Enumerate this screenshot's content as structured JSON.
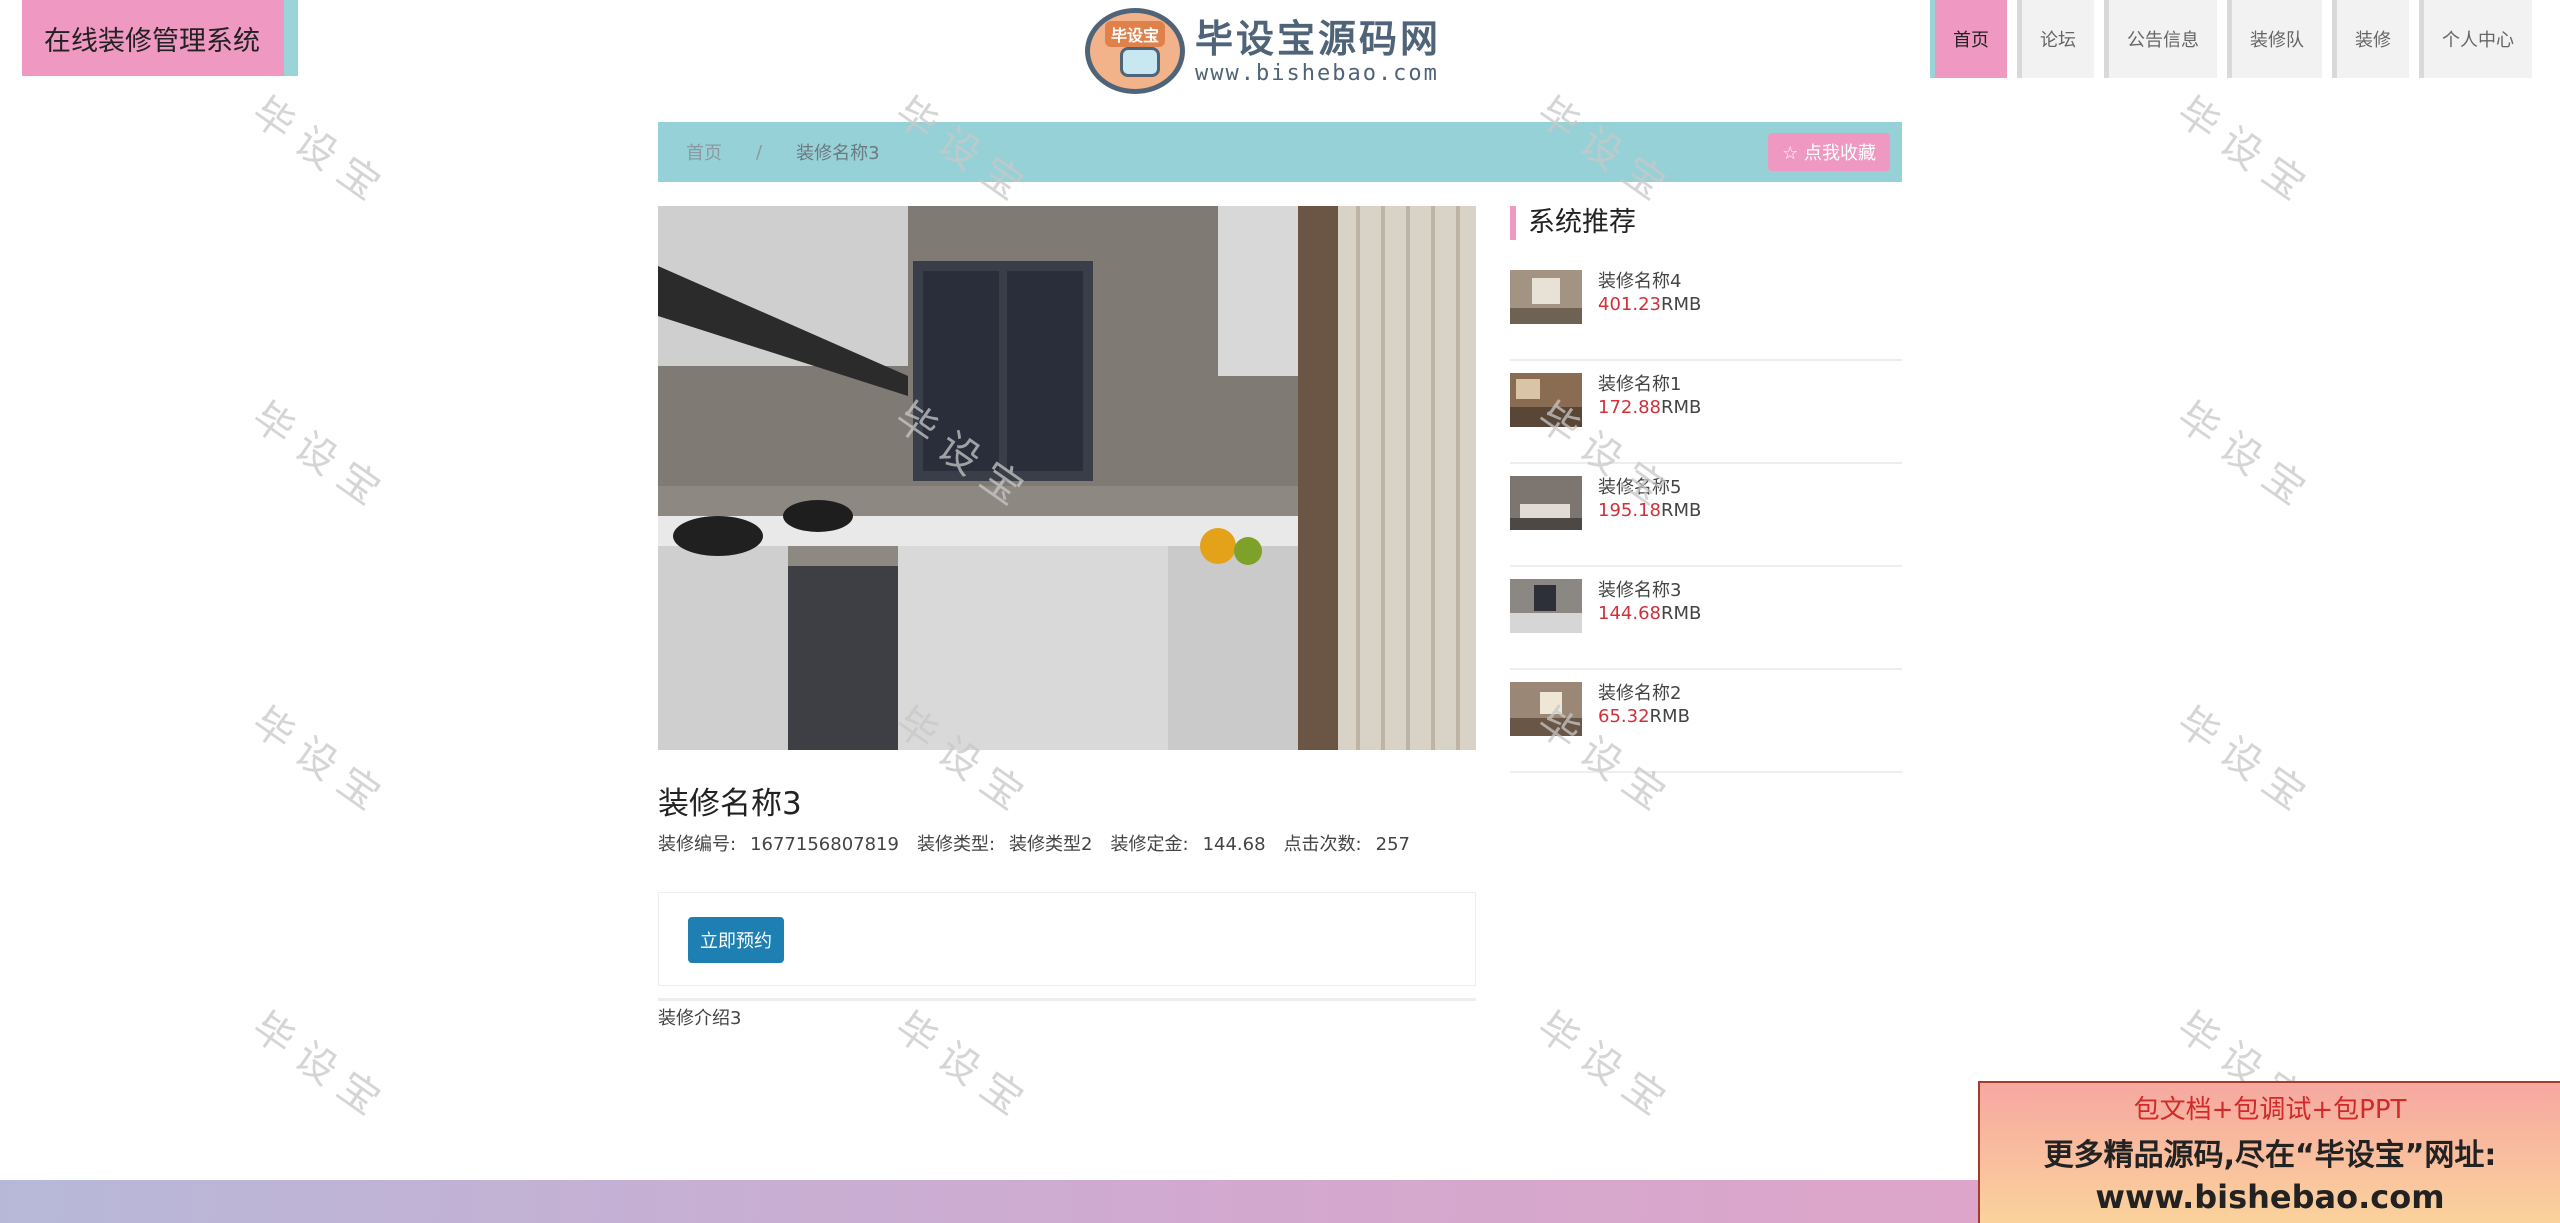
{
  "header": {
    "site_title": "在线装修管理系统",
    "logo": {
      "badge": "毕设宝",
      "name": "毕设宝源码网",
      "url": "www.bishebao.com"
    }
  },
  "nav": [
    {
      "label": "首页",
      "active": true
    },
    {
      "label": "论坛"
    },
    {
      "label": "公告信息"
    },
    {
      "label": "装修队"
    },
    {
      "label": "装修"
    },
    {
      "label": "个人中心"
    }
  ],
  "breadcrumb": {
    "home": "首页",
    "separator": "/",
    "current": "装修名称3",
    "favorite_label": "☆ 点我收藏"
  },
  "item": {
    "title": "装修名称3",
    "meta": [
      {
        "key": "装修编号:",
        "value": "1677156807819"
      },
      {
        "key": "装修类型:",
        "value": "装修类型2"
      },
      {
        "key": "装修定金:",
        "value": "144.68"
      },
      {
        "key": "点击次数:",
        "value": "257"
      }
    ],
    "book_label": "立即预约",
    "intro": "装修介绍3"
  },
  "sidebar": {
    "title": "系统推荐",
    "items": [
      {
        "name": "装修名称4",
        "price": "401.23",
        "unit": "RMB"
      },
      {
        "name": "装修名称1",
        "price": "172.88",
        "unit": "RMB"
      },
      {
        "name": "装修名称5",
        "price": "195.18",
        "unit": "RMB"
      },
      {
        "name": "装修名称3",
        "price": "144.68",
        "unit": "RMB"
      },
      {
        "name": "装修名称2",
        "price": "65.32",
        "unit": "RMB"
      }
    ]
  },
  "watermark": "毕设宝",
  "promo": {
    "line1": "包文档+包调试+包PPT",
    "line2": "更多精品源码,尽在“毕设宝”网址:",
    "line3": "www.bishebao.com"
  },
  "colors": {
    "pink": "#ef98c2",
    "teal": "#96d1d7",
    "button_blue": "#1d7fb2",
    "price_red": "#d0303a"
  }
}
